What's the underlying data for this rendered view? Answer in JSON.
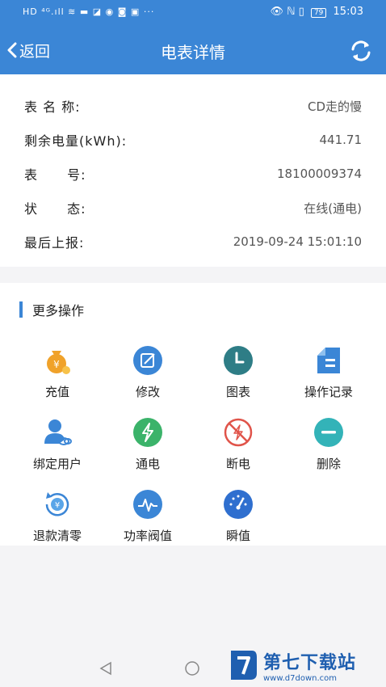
{
  "status_bar": {
    "left": "HD ⁴ᴳ.ıll ≋ ▬ ◪ ◉ ◙ ▣ ···",
    "icons": "👁 ℕ ▯",
    "battery": "79",
    "time": "15:03"
  },
  "nav": {
    "back_label": "返回",
    "title": "电表详情"
  },
  "info": {
    "rows": [
      {
        "label": "表 名 称:",
        "value": "CD走的慢"
      },
      {
        "label": "剩余电量(kWh):",
        "value": "441.71"
      },
      {
        "label": "表 号:",
        "value": "18100009374"
      },
      {
        "label": "状 态:",
        "value": "在线(通电)"
      },
      {
        "label": "最后上报:",
        "value": "2019-09-24 15:01:10"
      }
    ]
  },
  "ops": {
    "title": "更多操作",
    "items": [
      {
        "label": "充值",
        "icon": "money-bag-icon",
        "color": "#f0a22a"
      },
      {
        "label": "修改",
        "icon": "edit-icon",
        "color": "#3b86d6"
      },
      {
        "label": "图表",
        "icon": "clock-chart-icon",
        "color": "#2e7d86"
      },
      {
        "label": "操作记录",
        "icon": "document-icon",
        "color": "#3b86d6"
      },
      {
        "label": "绑定用户",
        "icon": "bind-user-icon",
        "color": "#3b86d6"
      },
      {
        "label": "通电",
        "icon": "power-on-icon",
        "color": "#3bb36a"
      },
      {
        "label": "断电",
        "icon": "power-off-icon",
        "color": "#e0544a"
      },
      {
        "label": "删除",
        "icon": "delete-icon",
        "color": "#33b3b8"
      },
      {
        "label": "退款清零",
        "icon": "refund-icon",
        "color": "#3b86d6"
      },
      {
        "label": "功率阀值",
        "icon": "power-threshold-icon",
        "color": "#3b86d6"
      },
      {
        "label": "瞬值",
        "icon": "gauge-icon",
        "color": "#2f6fcf"
      }
    ]
  },
  "watermark": {
    "title": "第七下载站",
    "url": "www.d7down.com"
  }
}
